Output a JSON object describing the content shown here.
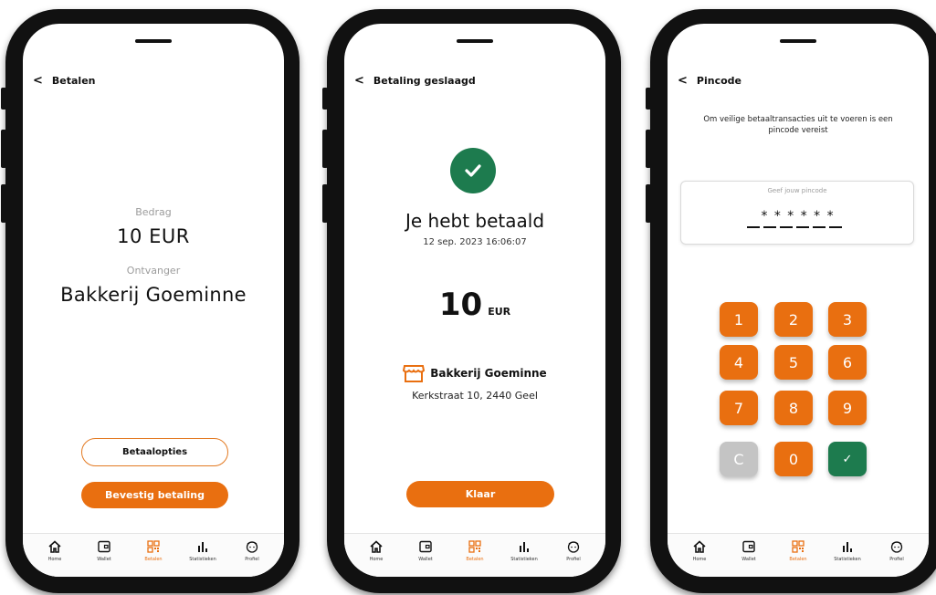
{
  "tabbar": {
    "items": [
      {
        "label": "Home",
        "icon": "home-icon"
      },
      {
        "label": "Wallet",
        "icon": "wallet-icon"
      },
      {
        "label": "Betalen",
        "icon": "qr-code-icon"
      },
      {
        "label": "Statistieken",
        "icon": "bar-chart-icon"
      },
      {
        "label": "Profiel",
        "icon": "profile-icon"
      }
    ],
    "active": "Betalen",
    "active_color": "#e96f10"
  },
  "screen1": {
    "title": "Betalen",
    "amount_label": "Bedrag",
    "amount": "10 EUR",
    "recipient_label": "Ontvanger",
    "recipient": "Bakkerij Goeminne",
    "options_button": "Betaalopties",
    "confirm_button": "Bevestig betaling"
  },
  "screen2": {
    "title": "Betaling geslaagd",
    "heading": "Je hebt betaald",
    "datetime": "12 sep. 2023 16:06:07",
    "amount": "10",
    "currency": "EUR",
    "merchant": "Bakkerij Goeminne",
    "address": "Kerkstraat 10, 2440 Geel",
    "done_button": "Klaar",
    "success_color": "#1d7b4e"
  },
  "screen3": {
    "title": "Pincode",
    "description": "Om veilige betaaltransacties uit te voeren is een pincode vereist",
    "pin_label": "Geef jouw pincode",
    "pin_masked": "******",
    "keys": [
      "1",
      "2",
      "3",
      "4",
      "5",
      "6",
      "7",
      "8",
      "9",
      "C",
      "0",
      "✓"
    ]
  },
  "colors": {
    "accent": "#e96f10",
    "success": "#1d7b4e",
    "muted": "#9c9c9c"
  }
}
